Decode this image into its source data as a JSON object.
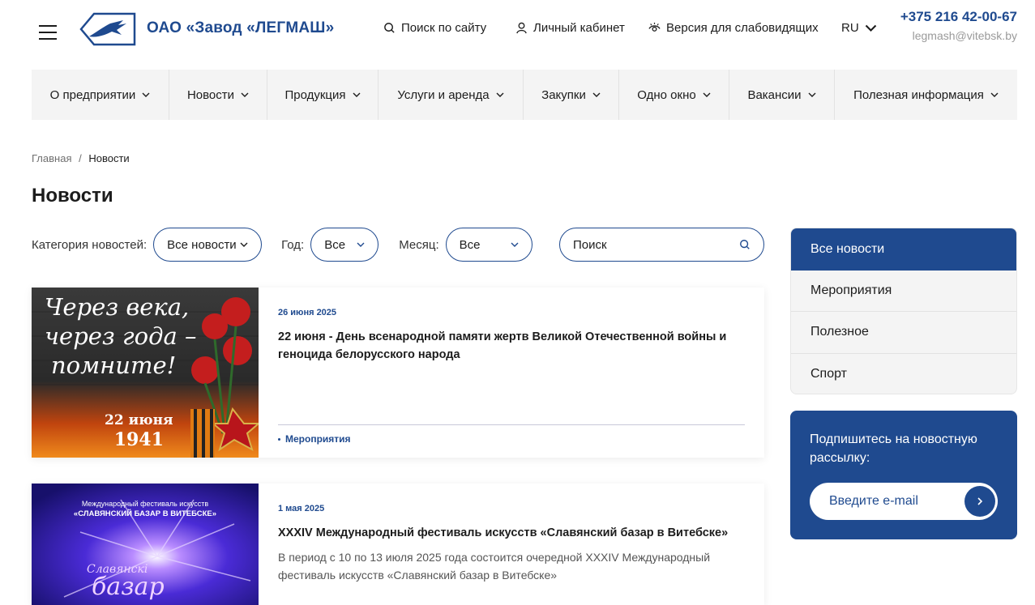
{
  "header": {
    "brand": "ОАО «Завод «ЛЕГМАШ»",
    "search_link": "Поиск по сайту",
    "account_link": "Личный кабинет",
    "accessibility_link": "Версия для слабовидящих",
    "language": "RU",
    "phone": "+375 216 42-00-67",
    "email": "legmash@vitebsk.by"
  },
  "nav": {
    "items": [
      {
        "label": "О предприятии"
      },
      {
        "label": "Новости"
      },
      {
        "label": "Продукция"
      },
      {
        "label": "Услуги и аренда"
      },
      {
        "label": "Закупки"
      },
      {
        "label": "Одно окно"
      },
      {
        "label": "Вакансии"
      },
      {
        "label": "Полезная информация"
      }
    ]
  },
  "breadcrumb": {
    "home": "Главная",
    "separator": "/",
    "current": "Новости"
  },
  "page_title": "Новости",
  "filters": {
    "category_label": "Категория новостей:",
    "category_value": "Все новости",
    "year_label": "Год:",
    "year_value": "Все",
    "month_label": "Месяц:",
    "month_value": "Все",
    "search_placeholder": "Поиск"
  },
  "news": [
    {
      "date": "26 июня 2025",
      "title": "22 июня - День всенародной памяти жертв Великой Отечественной войны и геноцида белорусского народа",
      "tag": "Мероприятия",
      "image_text_1": "Через века,",
      "image_text_2": "через года –",
      "image_text_3": "помните!",
      "image_text_4": "22 июня",
      "image_text_5": "1941"
    },
    {
      "date": "1 мая 2025",
      "title": "XXXIV Международный фестиваль искусств «Славянский базар в Витебске»",
      "description": "В период с 10 по 13 июля 2025 года состоится очередной XXXIV Международный фестиваль искусств «Славянский базар в Витебске»",
      "image_text_1": "Международный фестиваль искусств",
      "image_text_2": "«СЛАВЯНСКИЙ БАЗАР В ВИТЕБСКЕ»",
      "image_text_3": "Славянскі",
      "image_text_4": "базар"
    }
  ],
  "categories": {
    "items": [
      {
        "label": "Все новости",
        "active": true
      },
      {
        "label": "Мероприятия"
      },
      {
        "label": "Полезное"
      },
      {
        "label": "Спорт"
      }
    ]
  },
  "subscribe": {
    "title": "Подпишитесь на новостную рассылку:",
    "email_placeholder": "Введите e-mail"
  },
  "colors": {
    "brand": "#1f4a8f",
    "nav_bg": "#f4f4f4"
  }
}
